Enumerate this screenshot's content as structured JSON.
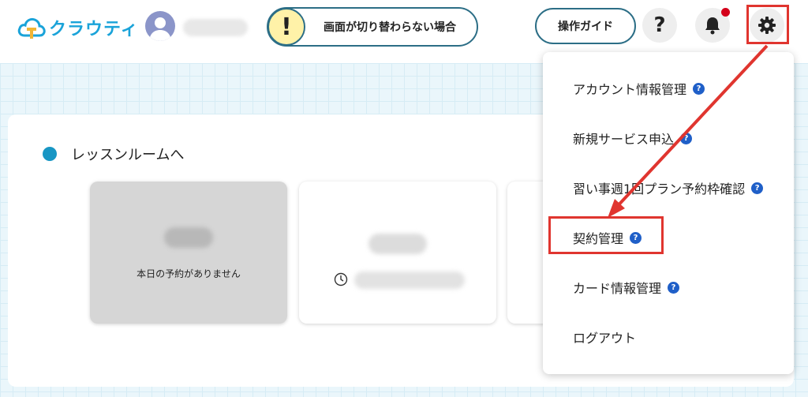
{
  "header": {
    "logo_text": "クラウティ",
    "alert_text": "画面が切り替わらない場合",
    "alert_mark": "!",
    "guide_button": "操作ガイド",
    "help_label": "?"
  },
  "main": {
    "section_title": "レッスンルームへ",
    "cards": [
      {
        "message": "本日の予約がありません"
      }
    ]
  },
  "menu": {
    "items": [
      {
        "label": "アカウント情報管理",
        "help": "?"
      },
      {
        "label": "新規サービス申込",
        "help": "?"
      },
      {
        "label": "習い事週1回プラン予約枠確認",
        "help": "?"
      },
      {
        "label": "契約管理",
        "help": "?"
      },
      {
        "label": "カード情報管理",
        "help": "?"
      },
      {
        "label": "ログアウト"
      }
    ]
  },
  "colors": {
    "accent": "#1aa3d9",
    "annotation": "#e0352f",
    "alert_fill": "#fff2a8",
    "badge": "#1f5fc8"
  },
  "icons": [
    "cloud-logo-icon",
    "user-avatar-icon",
    "question-icon",
    "bell-icon",
    "gear-icon",
    "clock-icon"
  ]
}
